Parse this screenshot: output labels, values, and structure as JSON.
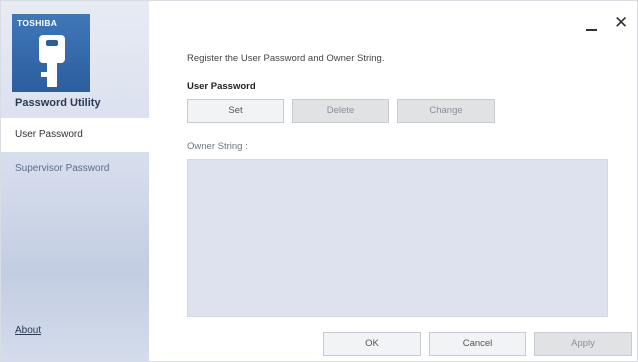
{
  "window": {
    "brand": "TOSHIBA",
    "app_name": "Password Utility",
    "controls": {
      "minimize_icon": "minimize-icon",
      "close_icon": "close-icon",
      "close_glyph": "✕"
    }
  },
  "sidebar": {
    "items": [
      {
        "label": "User Password",
        "selected": true
      },
      {
        "label": "Supervisor Password",
        "selected": false
      }
    ],
    "about_link": "About"
  },
  "main": {
    "intro_text": "Register the User Password and Owner String.",
    "user_password": {
      "title": "User Password",
      "buttons": {
        "set": "Set",
        "delete": "Delete",
        "change": "Change"
      }
    },
    "owner_string": {
      "label": "Owner String :",
      "value": ""
    }
  },
  "footer": {
    "ok": "OK",
    "cancel": "Cancel",
    "apply": "Apply"
  },
  "colors": {
    "accent": "#2c5e9e",
    "sidebar": "#d6dded",
    "owner_area": "#dde2ee"
  }
}
